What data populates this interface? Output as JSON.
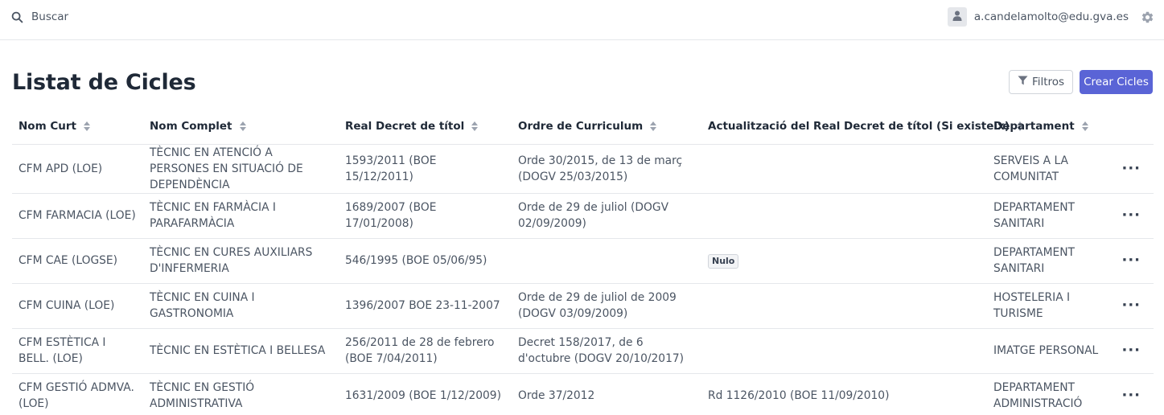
{
  "header": {
    "search_placeholder": "Buscar",
    "user_email": "a.candelamolto@edu.gva.es"
  },
  "page": {
    "title": "Listat de Cicles",
    "filter_label": "Filtros",
    "create_label": "Crear Cicles"
  },
  "colors": {
    "accent": "#5a64d6",
    "border": "#e5e7eb"
  },
  "table": {
    "columns": [
      "Nom Curt",
      "Nom Complet",
      "Real Decret de títol",
      "Ordre de Curriculum",
      "Actualització del Real Decret de títol (Si existeix)",
      "Departament"
    ],
    "rows": [
      {
        "nom_curt": "CFM APD (LOE)",
        "nom_complet": "TÈCNIC EN ATENCIÓ A PERSONES EN SITUACIÓ DE DEPENDÈNCIA",
        "real_decret": "1593/2011 (BOE 15/12/2011)",
        "ordre": "Orde 30/2015, de 13 de març (DOGV 25/03/2015)",
        "actualitzacio": "",
        "departament": "SERVEIS A LA COMUNITAT"
      },
      {
        "nom_curt": "CFM FARMACIA (LOE)",
        "nom_complet": "TÈCNIC EN FARMÀCIA I PARAFARMÀCIA",
        "real_decret": "1689/2007 (BOE 17/01/2008)",
        "ordre": "Orde de 29 de juliol (DOGV 02/09/2009)",
        "actualitzacio": "",
        "departament": "DEPARTAMENT SANITARI"
      },
      {
        "nom_curt": "CFM CAE (LOGSE)",
        "nom_complet": "TÈCNIC EN CURES AUXILIARS D'INFERMERIA",
        "real_decret": "546/1995 (BOE 05/06/95)",
        "ordre": "",
        "actualitzacio_badge": "Nulo",
        "departament": "DEPARTAMENT SANITARI"
      },
      {
        "nom_curt": "CFM CUINA (LOE)",
        "nom_complet": "TÈCNIC EN CUINA I GASTRONOMIA",
        "real_decret": "1396/2007 BOE 23-11-2007",
        "ordre": "Orde de 29 de juliol de 2009 (DOGV 03/09/2009)",
        "actualitzacio": "",
        "departament": "HOSTELERIA I TURISME"
      },
      {
        "nom_curt": "CFM ESTÈTICA I BELL. (LOE)",
        "nom_complet": "TÈCNIC EN ESTÈTICA I BELLESA",
        "real_decret": "256/2011 de 28 de febrero (BOE 7/04/2011)",
        "ordre": "Decret 158/2017, de 6 d'octubre (DOGV 20/10/2017)",
        "actualitzacio": "",
        "departament": "IMATGE PERSONAL"
      },
      {
        "nom_curt": "CFM GESTIÓ ADMVA. (LOE)",
        "nom_complet": "TÈCNIC EN GESTIÓ ADMINISTRATIVA",
        "real_decret": "1631/2009 (BOE 1/12/2009)",
        "ordre": "Orde 37/2012",
        "actualitzacio": "Rd 1126/2010 (BOE 11/09/2010)",
        "departament": "DEPARTAMENT ADMINISTRACIÓ"
      }
    ]
  }
}
